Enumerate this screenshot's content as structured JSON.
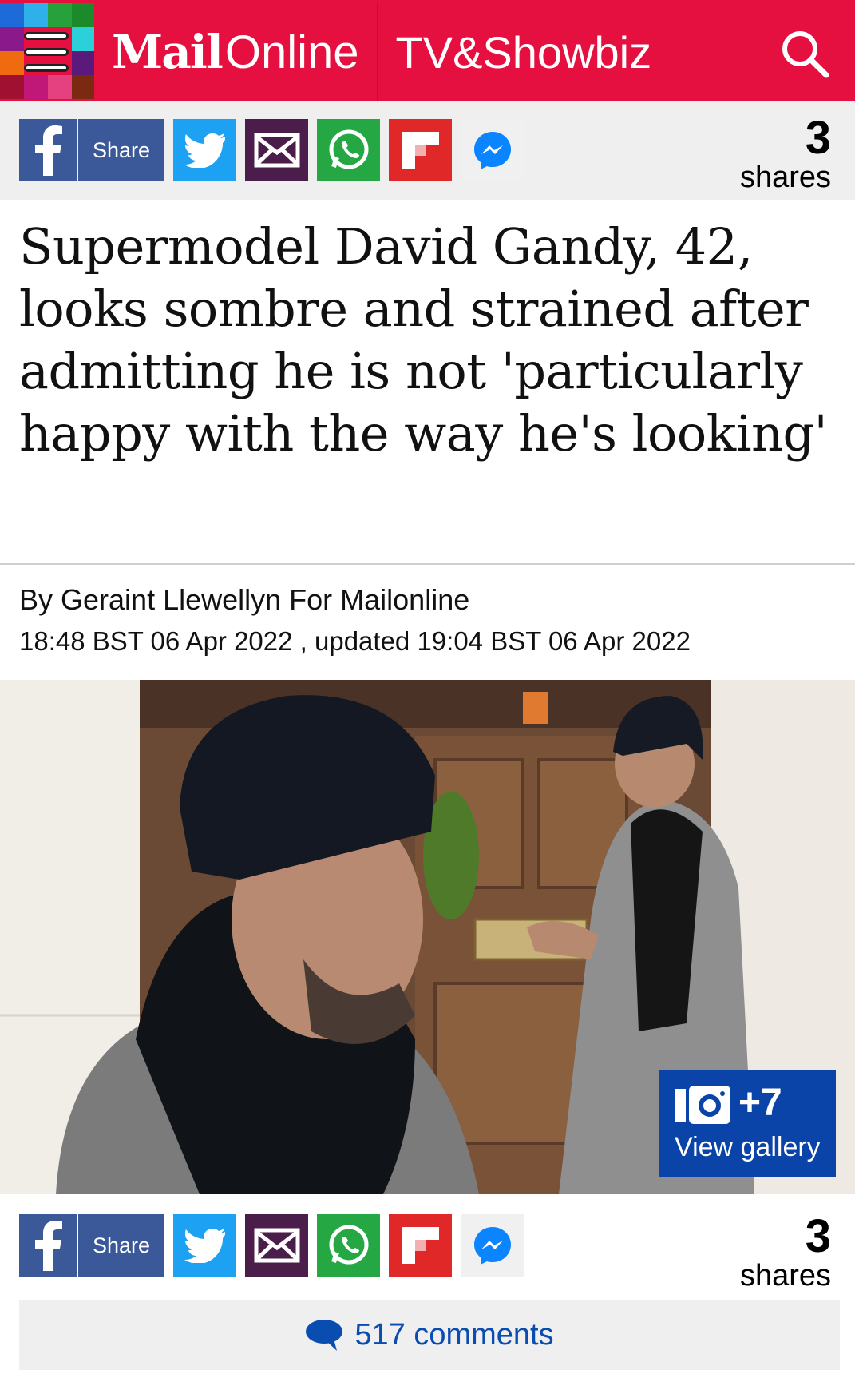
{
  "header": {
    "logo_mail": "Mail",
    "logo_online": "Online",
    "section": "TV&Showbiz",
    "menu_icon": "hamburger-icon",
    "search_icon": "search-icon",
    "brand_color": "#e5103f"
  },
  "share_top": {
    "facebook_label": "Share",
    "count": "3",
    "count_label": "shares"
  },
  "article": {
    "headline": "Supermodel David Gandy, 42, looks sombre and strained after admitting he is not 'particularly happy with the way he's looking'",
    "byline": "By Geraint Llewellyn For Mailonline",
    "dateline": "18:48 BST 06 Apr 2022 , updated 19:04 BST 06 Apr 2022"
  },
  "gallery": {
    "count": "+7",
    "label": "View gallery",
    "color": "#0a44a8"
  },
  "share_bottom": {
    "facebook_label": "Share",
    "count": "3",
    "count_label": "shares"
  },
  "comments": {
    "label": "517 comments",
    "color": "#0a4db0"
  }
}
